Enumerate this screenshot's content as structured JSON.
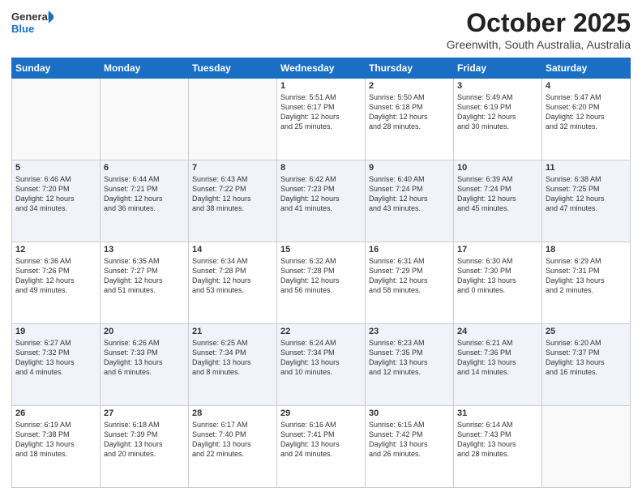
{
  "logo": {
    "line1": "General",
    "line2": "Blue"
  },
  "header": {
    "month": "October 2025",
    "location": "Greenwith, South Australia, Australia"
  },
  "days_of_week": [
    "Sunday",
    "Monday",
    "Tuesday",
    "Wednesday",
    "Thursday",
    "Friday",
    "Saturday"
  ],
  "weeks": [
    [
      {
        "day": "",
        "info": ""
      },
      {
        "day": "",
        "info": ""
      },
      {
        "day": "",
        "info": ""
      },
      {
        "day": "1",
        "info": "Sunrise: 5:51 AM\nSunset: 6:17 PM\nDaylight: 12 hours\nand 25 minutes."
      },
      {
        "day": "2",
        "info": "Sunrise: 5:50 AM\nSunset: 6:18 PM\nDaylight: 12 hours\nand 28 minutes."
      },
      {
        "day": "3",
        "info": "Sunrise: 5:49 AM\nSunset: 6:19 PM\nDaylight: 12 hours\nand 30 minutes."
      },
      {
        "day": "4",
        "info": "Sunrise: 5:47 AM\nSunset: 6:20 PM\nDaylight: 12 hours\nand 32 minutes."
      }
    ],
    [
      {
        "day": "5",
        "info": "Sunrise: 6:46 AM\nSunset: 7:20 PM\nDaylight: 12 hours\nand 34 minutes."
      },
      {
        "day": "6",
        "info": "Sunrise: 6:44 AM\nSunset: 7:21 PM\nDaylight: 12 hours\nand 36 minutes."
      },
      {
        "day": "7",
        "info": "Sunrise: 6:43 AM\nSunset: 7:22 PM\nDaylight: 12 hours\nand 38 minutes."
      },
      {
        "day": "8",
        "info": "Sunrise: 6:42 AM\nSunset: 7:23 PM\nDaylight: 12 hours\nand 41 minutes."
      },
      {
        "day": "9",
        "info": "Sunrise: 6:40 AM\nSunset: 7:24 PM\nDaylight: 12 hours\nand 43 minutes."
      },
      {
        "day": "10",
        "info": "Sunrise: 6:39 AM\nSunset: 7:24 PM\nDaylight: 12 hours\nand 45 minutes."
      },
      {
        "day": "11",
        "info": "Sunrise: 6:38 AM\nSunset: 7:25 PM\nDaylight: 12 hours\nand 47 minutes."
      }
    ],
    [
      {
        "day": "12",
        "info": "Sunrise: 6:36 AM\nSunset: 7:26 PM\nDaylight: 12 hours\nand 49 minutes."
      },
      {
        "day": "13",
        "info": "Sunrise: 6:35 AM\nSunset: 7:27 PM\nDaylight: 12 hours\nand 51 minutes."
      },
      {
        "day": "14",
        "info": "Sunrise: 6:34 AM\nSunset: 7:28 PM\nDaylight: 12 hours\nand 53 minutes."
      },
      {
        "day": "15",
        "info": "Sunrise: 6:32 AM\nSunset: 7:28 PM\nDaylight: 12 hours\nand 56 minutes."
      },
      {
        "day": "16",
        "info": "Sunrise: 6:31 AM\nSunset: 7:29 PM\nDaylight: 12 hours\nand 58 minutes."
      },
      {
        "day": "17",
        "info": "Sunrise: 6:30 AM\nSunset: 7:30 PM\nDaylight: 13 hours\nand 0 minutes."
      },
      {
        "day": "18",
        "info": "Sunrise: 6:29 AM\nSunset: 7:31 PM\nDaylight: 13 hours\nand 2 minutes."
      }
    ],
    [
      {
        "day": "19",
        "info": "Sunrise: 6:27 AM\nSunset: 7:32 PM\nDaylight: 13 hours\nand 4 minutes."
      },
      {
        "day": "20",
        "info": "Sunrise: 6:26 AM\nSunset: 7:33 PM\nDaylight: 13 hours\nand 6 minutes."
      },
      {
        "day": "21",
        "info": "Sunrise: 6:25 AM\nSunset: 7:34 PM\nDaylight: 13 hours\nand 8 minutes."
      },
      {
        "day": "22",
        "info": "Sunrise: 6:24 AM\nSunset: 7:34 PM\nDaylight: 13 hours\nand 10 minutes."
      },
      {
        "day": "23",
        "info": "Sunrise: 6:23 AM\nSunset: 7:35 PM\nDaylight: 13 hours\nand 12 minutes."
      },
      {
        "day": "24",
        "info": "Sunrise: 6:21 AM\nSunset: 7:36 PM\nDaylight: 13 hours\nand 14 minutes."
      },
      {
        "day": "25",
        "info": "Sunrise: 6:20 AM\nSunset: 7:37 PM\nDaylight: 13 hours\nand 16 minutes."
      }
    ],
    [
      {
        "day": "26",
        "info": "Sunrise: 6:19 AM\nSunset: 7:38 PM\nDaylight: 13 hours\nand 18 minutes."
      },
      {
        "day": "27",
        "info": "Sunrise: 6:18 AM\nSunset: 7:39 PM\nDaylight: 13 hours\nand 20 minutes."
      },
      {
        "day": "28",
        "info": "Sunrise: 6:17 AM\nSunset: 7:40 PM\nDaylight: 13 hours\nand 22 minutes."
      },
      {
        "day": "29",
        "info": "Sunrise: 6:16 AM\nSunset: 7:41 PM\nDaylight: 13 hours\nand 24 minutes."
      },
      {
        "day": "30",
        "info": "Sunrise: 6:15 AM\nSunset: 7:42 PM\nDaylight: 13 hours\nand 26 minutes."
      },
      {
        "day": "31",
        "info": "Sunrise: 6:14 AM\nSunset: 7:43 PM\nDaylight: 13 hours\nand 28 minutes."
      },
      {
        "day": "",
        "info": ""
      }
    ]
  ]
}
